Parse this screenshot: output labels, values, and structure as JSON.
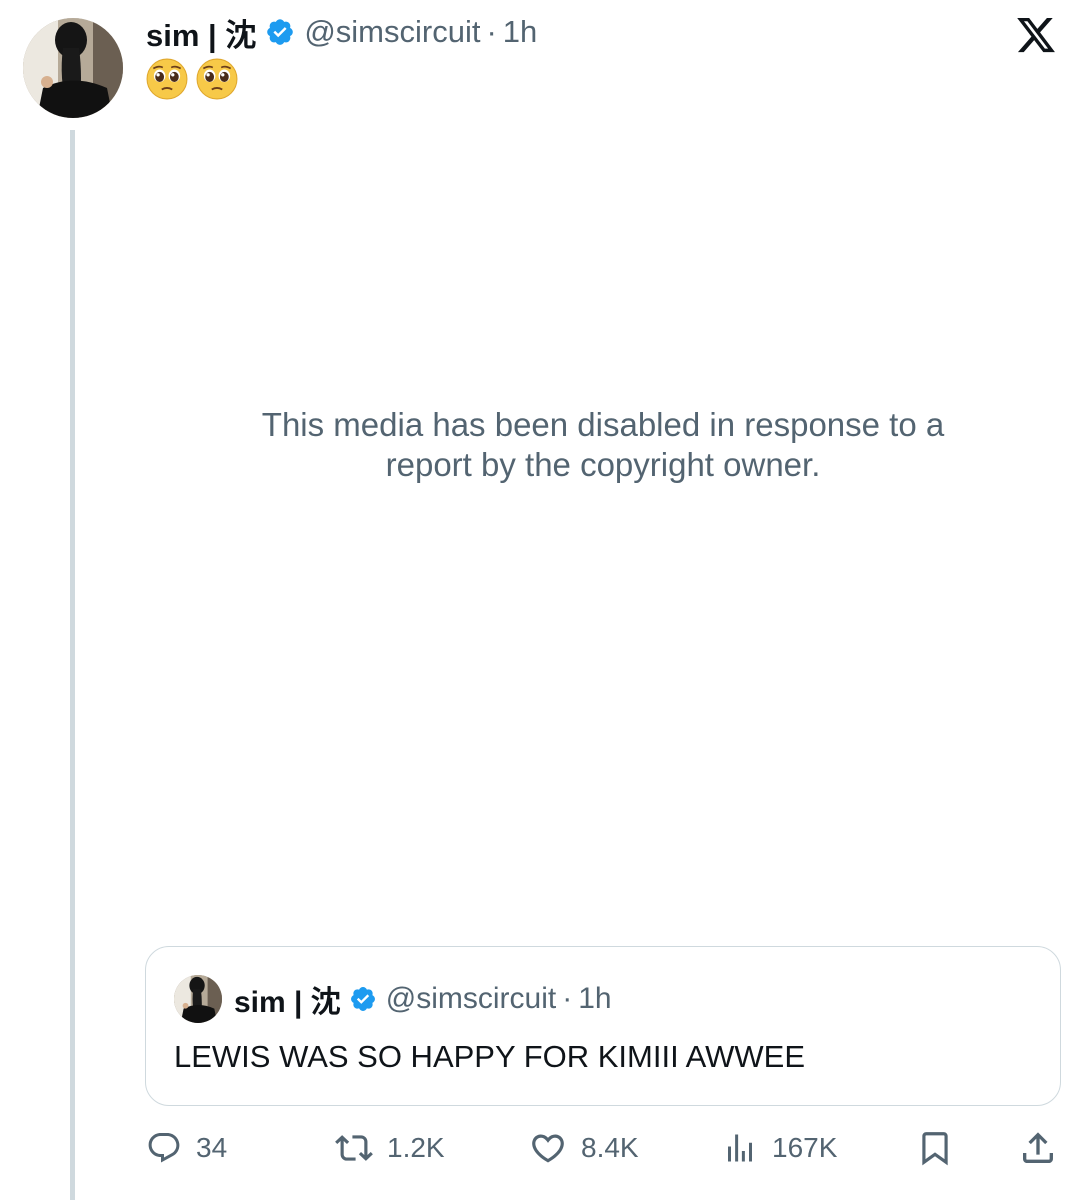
{
  "tweet": {
    "author": {
      "display_name": "sim | 沈",
      "handle": "@simscircuit",
      "verified": true,
      "avatar": "profile-photo"
    },
    "separator": "·",
    "time": "1h",
    "text_emojis": [
      "🥺",
      "🥺"
    ],
    "media_notice": "This media has been disabled in response to a report by the copyright owner.",
    "quoted": {
      "author": {
        "display_name": "sim | 沈",
        "handle": "@simscircuit",
        "verified": true
      },
      "separator": "·",
      "time": "1h",
      "text": "LEWIS WAS SO HAPPY FOR KIMIII AWWEE"
    },
    "stats": {
      "replies": "34",
      "retweets": "1.2K",
      "likes": "8.4K",
      "views": "167K"
    }
  },
  "brand": {
    "logo": "x-logo-icon",
    "verified_color": "#1d9bf0",
    "text_secondary": "#536471"
  }
}
